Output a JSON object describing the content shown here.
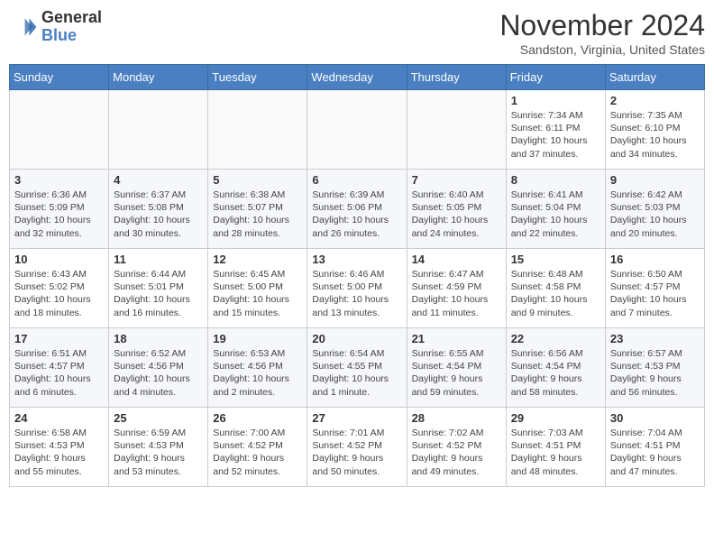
{
  "header": {
    "logo": {
      "text_general": "General",
      "text_blue": "Blue"
    },
    "month": "November 2024",
    "location": "Sandston, Virginia, United States"
  },
  "weekdays": [
    "Sunday",
    "Monday",
    "Tuesday",
    "Wednesday",
    "Thursday",
    "Friday",
    "Saturday"
  ],
  "weeks": [
    [
      {
        "day": "",
        "info": ""
      },
      {
        "day": "",
        "info": ""
      },
      {
        "day": "",
        "info": ""
      },
      {
        "day": "",
        "info": ""
      },
      {
        "day": "",
        "info": ""
      },
      {
        "day": "1",
        "info": "Sunrise: 7:34 AM\nSunset: 6:11 PM\nDaylight: 10 hours\nand 37 minutes."
      },
      {
        "day": "2",
        "info": "Sunrise: 7:35 AM\nSunset: 6:10 PM\nDaylight: 10 hours\nand 34 minutes."
      }
    ],
    [
      {
        "day": "3",
        "info": "Sunrise: 6:36 AM\nSunset: 5:09 PM\nDaylight: 10 hours\nand 32 minutes."
      },
      {
        "day": "4",
        "info": "Sunrise: 6:37 AM\nSunset: 5:08 PM\nDaylight: 10 hours\nand 30 minutes."
      },
      {
        "day": "5",
        "info": "Sunrise: 6:38 AM\nSunset: 5:07 PM\nDaylight: 10 hours\nand 28 minutes."
      },
      {
        "day": "6",
        "info": "Sunrise: 6:39 AM\nSunset: 5:06 PM\nDaylight: 10 hours\nand 26 minutes."
      },
      {
        "day": "7",
        "info": "Sunrise: 6:40 AM\nSunset: 5:05 PM\nDaylight: 10 hours\nand 24 minutes."
      },
      {
        "day": "8",
        "info": "Sunrise: 6:41 AM\nSunset: 5:04 PM\nDaylight: 10 hours\nand 22 minutes."
      },
      {
        "day": "9",
        "info": "Sunrise: 6:42 AM\nSunset: 5:03 PM\nDaylight: 10 hours\nand 20 minutes."
      }
    ],
    [
      {
        "day": "10",
        "info": "Sunrise: 6:43 AM\nSunset: 5:02 PM\nDaylight: 10 hours\nand 18 minutes."
      },
      {
        "day": "11",
        "info": "Sunrise: 6:44 AM\nSunset: 5:01 PM\nDaylight: 10 hours\nand 16 minutes."
      },
      {
        "day": "12",
        "info": "Sunrise: 6:45 AM\nSunset: 5:00 PM\nDaylight: 10 hours\nand 15 minutes."
      },
      {
        "day": "13",
        "info": "Sunrise: 6:46 AM\nSunset: 5:00 PM\nDaylight: 10 hours\nand 13 minutes."
      },
      {
        "day": "14",
        "info": "Sunrise: 6:47 AM\nSunset: 4:59 PM\nDaylight: 10 hours\nand 11 minutes."
      },
      {
        "day": "15",
        "info": "Sunrise: 6:48 AM\nSunset: 4:58 PM\nDaylight: 10 hours\nand 9 minutes."
      },
      {
        "day": "16",
        "info": "Sunrise: 6:50 AM\nSunset: 4:57 PM\nDaylight: 10 hours\nand 7 minutes."
      }
    ],
    [
      {
        "day": "17",
        "info": "Sunrise: 6:51 AM\nSunset: 4:57 PM\nDaylight: 10 hours\nand 6 minutes."
      },
      {
        "day": "18",
        "info": "Sunrise: 6:52 AM\nSunset: 4:56 PM\nDaylight: 10 hours\nand 4 minutes."
      },
      {
        "day": "19",
        "info": "Sunrise: 6:53 AM\nSunset: 4:56 PM\nDaylight: 10 hours\nand 2 minutes."
      },
      {
        "day": "20",
        "info": "Sunrise: 6:54 AM\nSunset: 4:55 PM\nDaylight: 10 hours\nand 1 minute."
      },
      {
        "day": "21",
        "info": "Sunrise: 6:55 AM\nSunset: 4:54 PM\nDaylight: 9 hours\nand 59 minutes."
      },
      {
        "day": "22",
        "info": "Sunrise: 6:56 AM\nSunset: 4:54 PM\nDaylight: 9 hours\nand 58 minutes."
      },
      {
        "day": "23",
        "info": "Sunrise: 6:57 AM\nSunset: 4:53 PM\nDaylight: 9 hours\nand 56 minutes."
      }
    ],
    [
      {
        "day": "24",
        "info": "Sunrise: 6:58 AM\nSunset: 4:53 PM\nDaylight: 9 hours\nand 55 minutes."
      },
      {
        "day": "25",
        "info": "Sunrise: 6:59 AM\nSunset: 4:53 PM\nDaylight: 9 hours\nand 53 minutes."
      },
      {
        "day": "26",
        "info": "Sunrise: 7:00 AM\nSunset: 4:52 PM\nDaylight: 9 hours\nand 52 minutes."
      },
      {
        "day": "27",
        "info": "Sunrise: 7:01 AM\nSunset: 4:52 PM\nDaylight: 9 hours\nand 50 minutes."
      },
      {
        "day": "28",
        "info": "Sunrise: 7:02 AM\nSunset: 4:52 PM\nDaylight: 9 hours\nand 49 minutes."
      },
      {
        "day": "29",
        "info": "Sunrise: 7:03 AM\nSunset: 4:51 PM\nDaylight: 9 hours\nand 48 minutes."
      },
      {
        "day": "30",
        "info": "Sunrise: 7:04 AM\nSunset: 4:51 PM\nDaylight: 9 hours\nand 47 minutes."
      }
    ]
  ]
}
